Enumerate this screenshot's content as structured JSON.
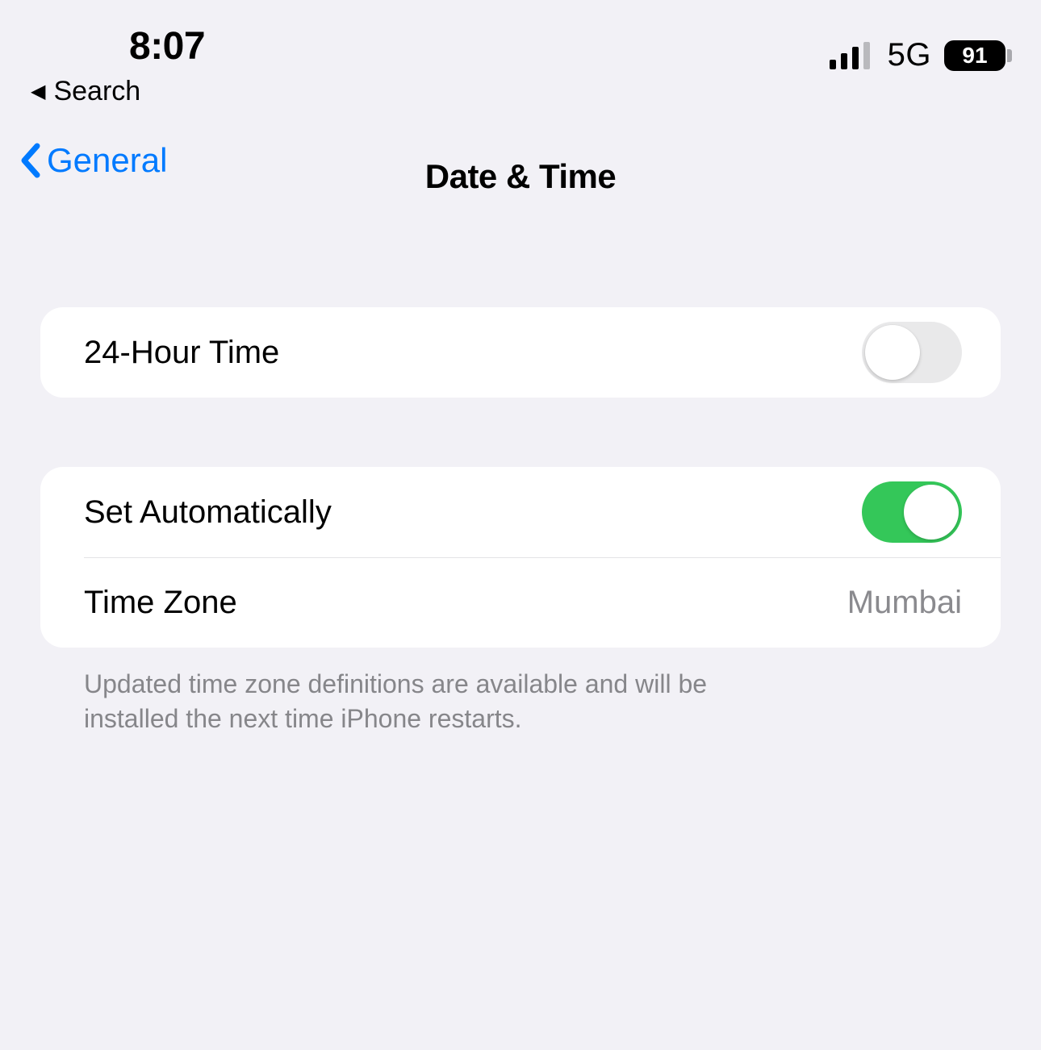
{
  "status_bar": {
    "time": "8:07",
    "network_type": "5G",
    "battery_percent": "91"
  },
  "breadcrumb": {
    "label": "Search"
  },
  "navbar": {
    "back_label": "General",
    "title": "Date & Time"
  },
  "section_time_format": {
    "twenty_four_hour": {
      "label": "24-Hour Time",
      "on": false
    }
  },
  "section_auto": {
    "set_automatically": {
      "label": "Set Automatically",
      "on": true
    },
    "time_zone": {
      "label": "Time Zone",
      "value": "Mumbai"
    }
  },
  "footer_note": "Updated time zone definitions are available and will be installed the next time iPhone restarts."
}
